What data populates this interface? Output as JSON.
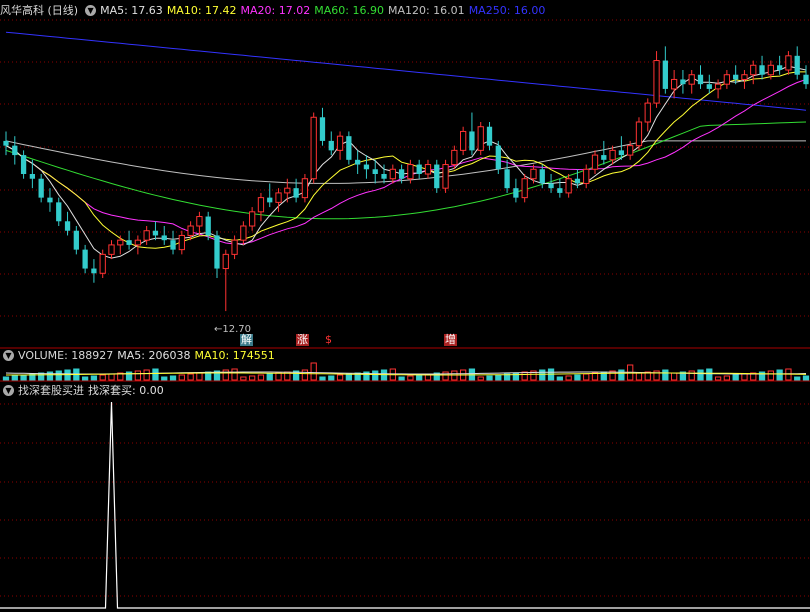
{
  "main_panel": {
    "stock_title": "风华高科 (日线)",
    "ma5": {
      "label": "MA5: 17.63",
      "color": "#e0e0e0"
    },
    "ma10": {
      "label": "MA10: 17.42",
      "color": "#ffff33"
    },
    "ma20": {
      "label": "MA20: 17.02",
      "color": "#ff33ff"
    },
    "ma60": {
      "label": "MA60: 16.90",
      "color": "#33dd33"
    },
    "ma120": {
      "label": "MA120: 16.01",
      "color": "#c0c0c0"
    },
    "ma250": {
      "label": "MA250: 16.00",
      "color": "#3333ff"
    },
    "low_label": "12.70",
    "markers": [
      {
        "text": "解",
        "color": "#ffffff",
        "bg": "#3a7a8a"
      },
      {
        "text": "涨",
        "color": "#ffffff",
        "bg": "#aa2222"
      },
      {
        "text": "$",
        "color": "#ff3333",
        "bg": "transparent"
      },
      {
        "text": "增",
        "color": "#ffffff",
        "bg": "#aa2222"
      }
    ]
  },
  "volume_panel": {
    "volume_label": "VOLUME: 188927",
    "ma5_label": "MA5: 206038",
    "ma10_label": "MA10: 174551"
  },
  "indicator_panel": {
    "name": "找深套股买进",
    "value_label": "找深套买: 0.00"
  },
  "colors": {
    "up": "#ff3333",
    "down": "#33cccc",
    "grid": "#8b0000",
    "separator": "#aa0000",
    "indicator": "#ffffff"
  },
  "chart_data": {
    "type": "candlestick",
    "price_range": [
      12.3,
      18.9
    ],
    "candles": [
      [
        16.3,
        16.5,
        16.0,
        16.2
      ],
      [
        16.2,
        16.4,
        15.8,
        16.0
      ],
      [
        16.0,
        16.1,
        15.5,
        15.6
      ],
      [
        15.6,
        15.9,
        15.3,
        15.5
      ],
      [
        15.5,
        15.6,
        15.0,
        15.1
      ],
      [
        15.1,
        15.3,
        14.8,
        15.0
      ],
      [
        15.0,
        15.1,
        14.5,
        14.6
      ],
      [
        14.6,
        14.8,
        14.3,
        14.4
      ],
      [
        14.4,
        14.5,
        13.9,
        14.0
      ],
      [
        14.0,
        14.1,
        13.5,
        13.6
      ],
      [
        13.6,
        13.8,
        13.3,
        13.5
      ],
      [
        13.5,
        14.0,
        13.4,
        13.9
      ],
      [
        13.9,
        14.2,
        13.8,
        14.1
      ],
      [
        14.1,
        14.3,
        13.9,
        14.2
      ],
      [
        14.2,
        14.4,
        14.0,
        14.1
      ],
      [
        14.1,
        14.3,
        13.9,
        14.2
      ],
      [
        14.2,
        14.5,
        14.1,
        14.4
      ],
      [
        14.4,
        14.6,
        14.2,
        14.3
      ],
      [
        14.3,
        14.5,
        14.1,
        14.2
      ],
      [
        14.2,
        14.4,
        13.9,
        14.0
      ],
      [
        14.0,
        14.4,
        13.9,
        14.3
      ],
      [
        14.3,
        14.6,
        14.2,
        14.5
      ],
      [
        14.5,
        14.8,
        14.3,
        14.7
      ],
      [
        14.7,
        14.8,
        14.2,
        14.3
      ],
      [
        14.3,
        14.4,
        13.4,
        13.6
      ],
      [
        13.6,
        14.0,
        12.7,
        13.9
      ],
      [
        13.9,
        14.3,
        13.8,
        14.2
      ],
      [
        14.2,
        14.6,
        14.1,
        14.5
      ],
      [
        14.5,
        14.9,
        14.4,
        14.8
      ],
      [
        14.8,
        15.2,
        14.6,
        15.1
      ],
      [
        15.1,
        15.4,
        14.9,
        15.0
      ],
      [
        15.0,
        15.3,
        14.8,
        15.2
      ],
      [
        15.2,
        15.5,
        15.0,
        15.3
      ],
      [
        15.3,
        15.5,
        15.0,
        15.1
      ],
      [
        15.1,
        15.6,
        15.0,
        15.5
      ],
      [
        15.5,
        16.9,
        15.4,
        16.8
      ],
      [
        16.8,
        17.0,
        16.2,
        16.3
      ],
      [
        16.3,
        16.5,
        16.0,
        16.1
      ],
      [
        16.1,
        16.5,
        15.9,
        16.4
      ],
      [
        16.4,
        16.5,
        15.8,
        15.9
      ],
      [
        15.9,
        16.1,
        15.6,
        15.8
      ],
      [
        15.8,
        16.0,
        15.5,
        15.7
      ],
      [
        15.7,
        15.9,
        15.4,
        15.6
      ],
      [
        15.6,
        15.8,
        15.4,
        15.5
      ],
      [
        15.5,
        15.8,
        15.4,
        15.7
      ],
      [
        15.7,
        15.8,
        15.4,
        15.5
      ],
      [
        15.5,
        15.9,
        15.4,
        15.8
      ],
      [
        15.8,
        15.9,
        15.5,
        15.6
      ],
      [
        15.6,
        15.9,
        15.5,
        15.8
      ],
      [
        15.8,
        15.9,
        15.2,
        15.3
      ],
      [
        15.3,
        15.9,
        15.2,
        15.8
      ],
      [
        15.8,
        16.2,
        15.7,
        16.1
      ],
      [
        16.1,
        16.6,
        16.0,
        16.5
      ],
      [
        16.5,
        16.9,
        16.0,
        16.1
      ],
      [
        16.1,
        16.7,
        16.0,
        16.6
      ],
      [
        16.6,
        16.7,
        16.1,
        16.2
      ],
      [
        16.2,
        16.3,
        15.6,
        15.7
      ],
      [
        15.7,
        15.9,
        15.2,
        15.3
      ],
      [
        15.3,
        15.5,
        15.0,
        15.1
      ],
      [
        15.1,
        15.6,
        15.0,
        15.5
      ],
      [
        15.5,
        15.8,
        15.4,
        15.7
      ],
      [
        15.7,
        15.8,
        15.3,
        15.4
      ],
      [
        15.4,
        15.6,
        15.2,
        15.3
      ],
      [
        15.3,
        15.5,
        15.1,
        15.2
      ],
      [
        15.2,
        15.6,
        15.1,
        15.5
      ],
      [
        15.5,
        15.7,
        15.3,
        15.4
      ],
      [
        15.4,
        15.8,
        15.3,
        15.7
      ],
      [
        15.7,
        16.1,
        15.6,
        16.0
      ],
      [
        16.0,
        16.3,
        15.8,
        15.9
      ],
      [
        15.9,
        16.2,
        15.8,
        16.1
      ],
      [
        16.1,
        16.4,
        15.9,
        16.0
      ],
      [
        16.0,
        16.3,
        15.9,
        16.2
      ],
      [
        16.2,
        16.8,
        16.1,
        16.7
      ],
      [
        16.7,
        17.2,
        16.5,
        17.1
      ],
      [
        17.1,
        18.2,
        17.0,
        18.0
      ],
      [
        18.0,
        18.3,
        17.3,
        17.4
      ],
      [
        17.4,
        17.8,
        17.2,
        17.6
      ],
      [
        17.6,
        17.8,
        17.3,
        17.5
      ],
      [
        17.5,
        17.8,
        17.3,
        17.7
      ],
      [
        17.7,
        17.9,
        17.4,
        17.5
      ],
      [
        17.5,
        17.7,
        17.3,
        17.4
      ],
      [
        17.4,
        17.6,
        17.2,
        17.5
      ],
      [
        17.5,
        17.8,
        17.4,
        17.7
      ],
      [
        17.7,
        17.9,
        17.5,
        17.6
      ],
      [
        17.6,
        17.8,
        17.4,
        17.7
      ],
      [
        17.7,
        18.0,
        17.5,
        17.9
      ],
      [
        17.9,
        18.1,
        17.6,
        17.7
      ],
      [
        17.7,
        18.0,
        17.6,
        17.9
      ],
      [
        17.9,
        18.1,
        17.7,
        17.8
      ],
      [
        17.8,
        18.2,
        17.7,
        18.1
      ],
      [
        18.1,
        18.3,
        17.6,
        17.7
      ],
      [
        17.7,
        17.9,
        17.4,
        17.5
      ]
    ],
    "signal_bar_index": 12
  }
}
